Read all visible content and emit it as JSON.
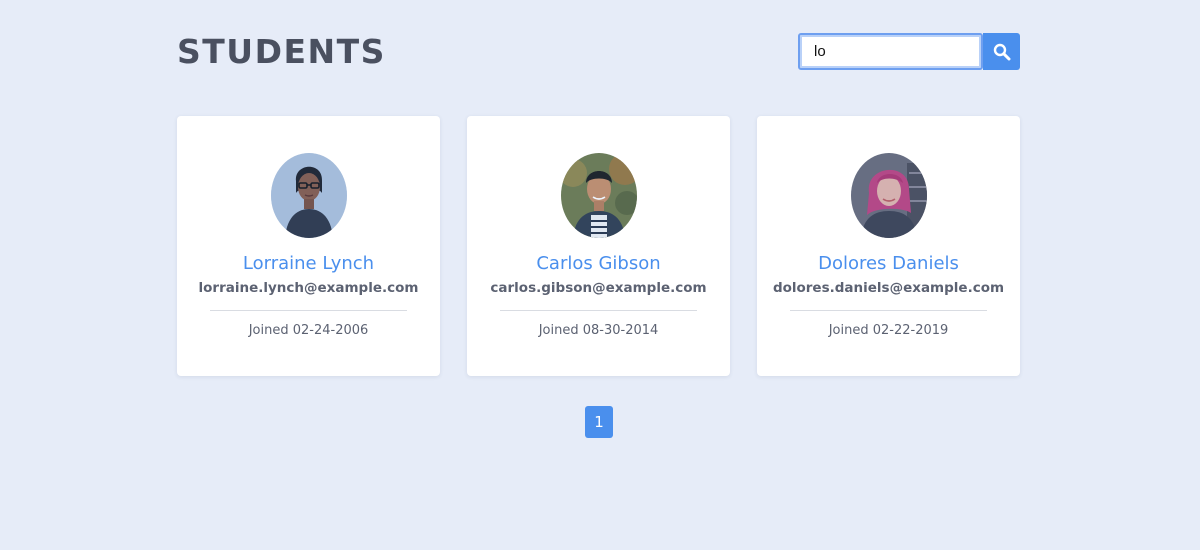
{
  "header": {
    "title": "STUDENTS"
  },
  "search": {
    "value": "lo",
    "button_icon": "search-icon"
  },
  "students": [
    {
      "name": "Lorraine Lynch",
      "email": "lorraine.lynch@example.com",
      "joined": "Joined 02-24-2006"
    },
    {
      "name": "Carlos Gibson",
      "email": "carlos.gibson@example.com",
      "joined": "Joined 08-30-2014"
    },
    {
      "name": "Dolores Daniels",
      "email": "dolores.daniels@example.com",
      "joined": "Joined 02-22-2019"
    }
  ],
  "pagination": {
    "pages": [
      "1"
    ],
    "active": "1"
  },
  "colors": {
    "accent": "#4a8fed",
    "background": "#e6ecf8",
    "title": "#4a5060"
  }
}
